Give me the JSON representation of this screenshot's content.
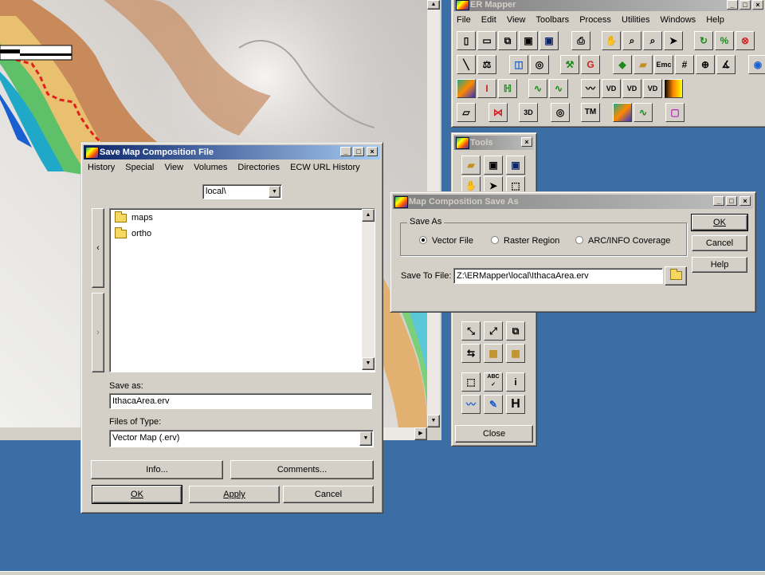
{
  "map_window": {
    "scroll_up": "▲",
    "scroll_down": "▼",
    "scroll_right": "▶"
  },
  "ermapper": {
    "title": "ER Mapper",
    "menu": [
      "File",
      "Edit",
      "View",
      "Toolbars",
      "Process",
      "Utilities",
      "Windows",
      "Help"
    ]
  },
  "tools": {
    "title": "Tools",
    "close_label": "Close",
    "glyph_text": "H",
    "abc_text": "ABC"
  },
  "save_dialog": {
    "title": "Save Map Composition File",
    "menu": [
      "History",
      "Special",
      "View",
      "Volumes",
      "Directories",
      "ECW URL History"
    ],
    "directory": "local\\",
    "folders": [
      "maps",
      "ortho"
    ],
    "save_as_label": "Save as:",
    "save_as_value": "IthacaArea.erv",
    "files_of_type_label": "Files of Type:",
    "files_of_type_value": "Vector Map (.erv)",
    "info_label": "Info...",
    "comments_label": "Comments...",
    "ok_label": "OK",
    "apply_label": "Apply",
    "cancel_label": "Cancel"
  },
  "save_as_dialog": {
    "title": "Map Composition Save As",
    "group_label": "Save As",
    "options": [
      {
        "label": "Vector File",
        "selected": true
      },
      {
        "label": "Raster Region",
        "selected": false
      },
      {
        "label": "ARC/INFO Coverage",
        "selected": false
      }
    ],
    "save_to_label": "Save To File:",
    "save_to_value": "Z:\\ERMapper\\local\\IthacaArea.erv",
    "ok_label": "OK",
    "cancel_label": "Cancel",
    "help_label": "Help"
  },
  "colors": {
    "desktop": "#3a6ea5",
    "title_active": "#0a246a",
    "title_inactive": "#808080",
    "face": "#d4d0c8"
  }
}
